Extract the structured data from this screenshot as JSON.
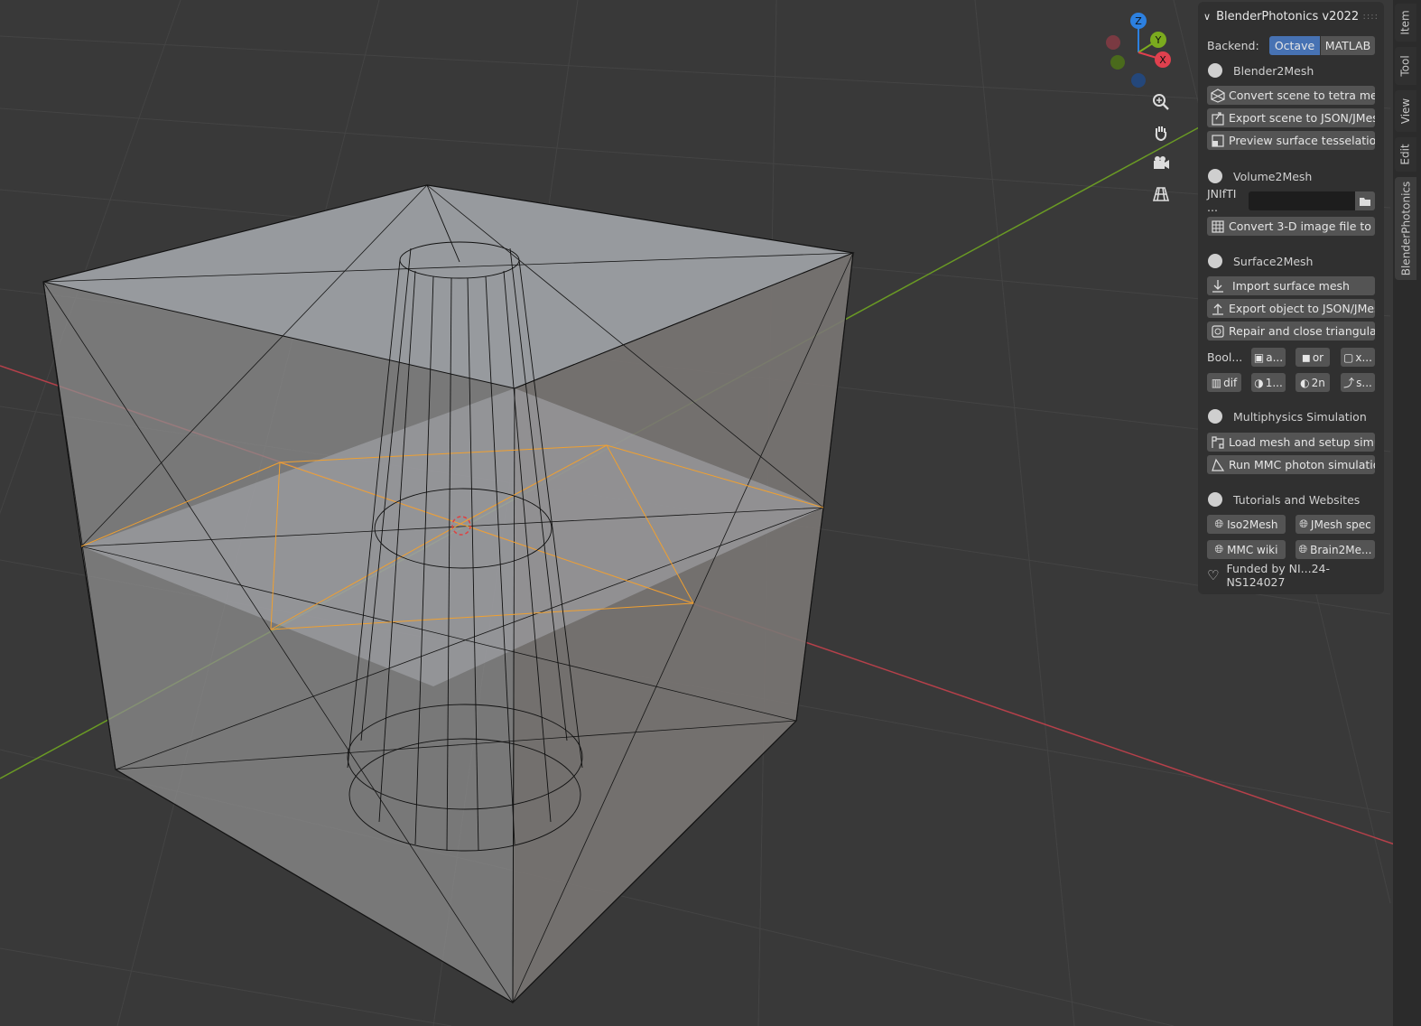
{
  "panel": {
    "title": "BlenderPhotonics v2022",
    "backend_label": "Backend:",
    "backend_options": [
      "Octave",
      "MATLAB"
    ],
    "backend_selected": "Octave",
    "blender2mesh": {
      "title": "Blender2Mesh",
      "convert": "Convert scene to tetra mesh",
      "export": "Export scene to JSON/JMesh",
      "preview": "Preview surface tesselation"
    },
    "volume2mesh": {
      "title": "Volume2Mesh",
      "jnifti_label": "JNIfTI ...",
      "jnifti_value": "",
      "convert": "Convert 3-D image file to ..."
    },
    "surface2mesh": {
      "title": "Surface2Mesh",
      "import": "Import surface mesh",
      "export": "Export object to JSON/JMesh",
      "repair": "Repair and close triangular ...",
      "bool_label": "Bool...",
      "bool_ops": [
        "a...",
        "or",
        "x...",
        "dif",
        "1...",
        "2n",
        "s..."
      ]
    },
    "multiphysics": {
      "title": "Multiphysics Simulation",
      "load": "Load mesh and setup simul...",
      "run": "Run MMC photon simulation"
    },
    "tutorials": {
      "title": "Tutorials and Websites",
      "links": [
        "Iso2Mesh",
        "JMesh spec",
        "MMC wiki",
        "Brain2Me..."
      ]
    },
    "funded": "Funded by NI...24-NS124027"
  },
  "tabs": [
    "Item",
    "Tool",
    "View",
    "Edit",
    "BlenderPhotonics"
  ],
  "active_tab": "BlenderPhotonics",
  "gizmo": {
    "axes": [
      "Z",
      "Y",
      "X"
    ]
  },
  "colors": {
    "viewport_bg": "#393939",
    "accent": "#4772b3",
    "x_axis": "#e0404e",
    "y_axis": "#7bab1e",
    "z_axis": "#2c80e0",
    "selection": "#f0a030"
  }
}
